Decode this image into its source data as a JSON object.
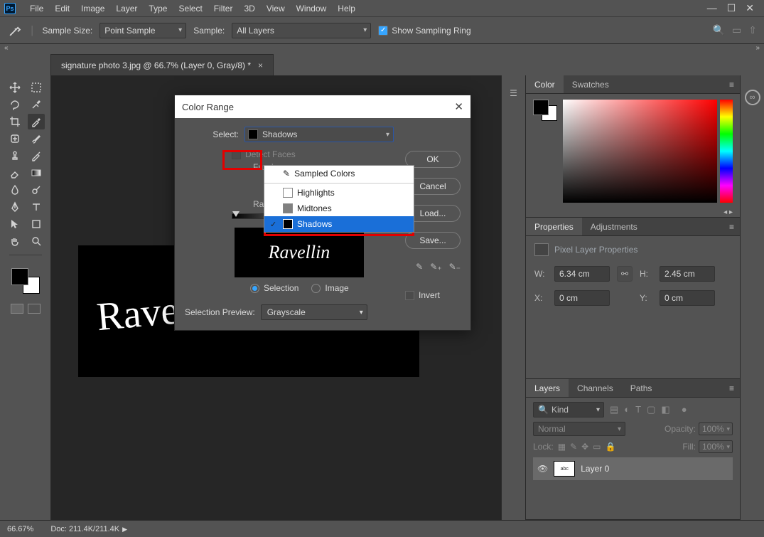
{
  "menubar": {
    "logo": "Ps",
    "items": [
      "File",
      "Edit",
      "Image",
      "Layer",
      "Type",
      "Select",
      "Filter",
      "3D",
      "View",
      "Window",
      "Help"
    ]
  },
  "options_bar": {
    "sample_size_label": "Sample Size:",
    "sample_size_value": "Point Sample",
    "sample_label": "Sample:",
    "sample_value": "All Layers",
    "show_sampling_ring": "Show Sampling Ring"
  },
  "document": {
    "tab_title": "signature photo 3.jpg @ 66.7% (Layer 0, Gray/8) *",
    "signature_text": "Ravellin"
  },
  "dialog": {
    "title": "Color Range",
    "select_label": "Select:",
    "select_value": "Shadows",
    "detect_faces": "Detect Faces",
    "fuzziness_label": "Fuzziness:",
    "range_label": "Range:",
    "selection_radio": "Selection",
    "image_radio": "Image",
    "selection_preview_label": "Selection Preview:",
    "selection_preview_value": "Grayscale",
    "buttons": {
      "ok": "OK",
      "cancel": "Cancel",
      "load": "Load...",
      "save": "Save..."
    },
    "invert": "Invert",
    "dropdown": {
      "sampled": "Sampled Colors",
      "highlights": "Highlights",
      "midtones": "Midtones",
      "shadows": "Shadows"
    }
  },
  "panels": {
    "color": {
      "tab_color": "Color",
      "tab_swatches": "Swatches"
    },
    "properties": {
      "tab_props": "Properties",
      "tab_adjust": "Adjustments",
      "title": "Pixel Layer Properties",
      "w_label": "W:",
      "w_value": "6.34 cm",
      "h_label": "H:",
      "h_value": "2.45 cm",
      "x_label": "X:",
      "x_value": "0 cm",
      "y_label": "Y:",
      "y_value": "0 cm"
    },
    "layers": {
      "tab_layers": "Layers",
      "tab_channels": "Channels",
      "tab_paths": "Paths",
      "kind_label": "Kind",
      "blend_mode": "Normal",
      "opacity_label": "Opacity:",
      "opacity_value": "100%",
      "lock_label": "Lock:",
      "fill_label": "Fill:",
      "fill_value": "100%",
      "layer0": "Layer 0"
    }
  },
  "status": {
    "zoom": "66.67%",
    "doc": "Doc: 211.4K/211.4K"
  }
}
